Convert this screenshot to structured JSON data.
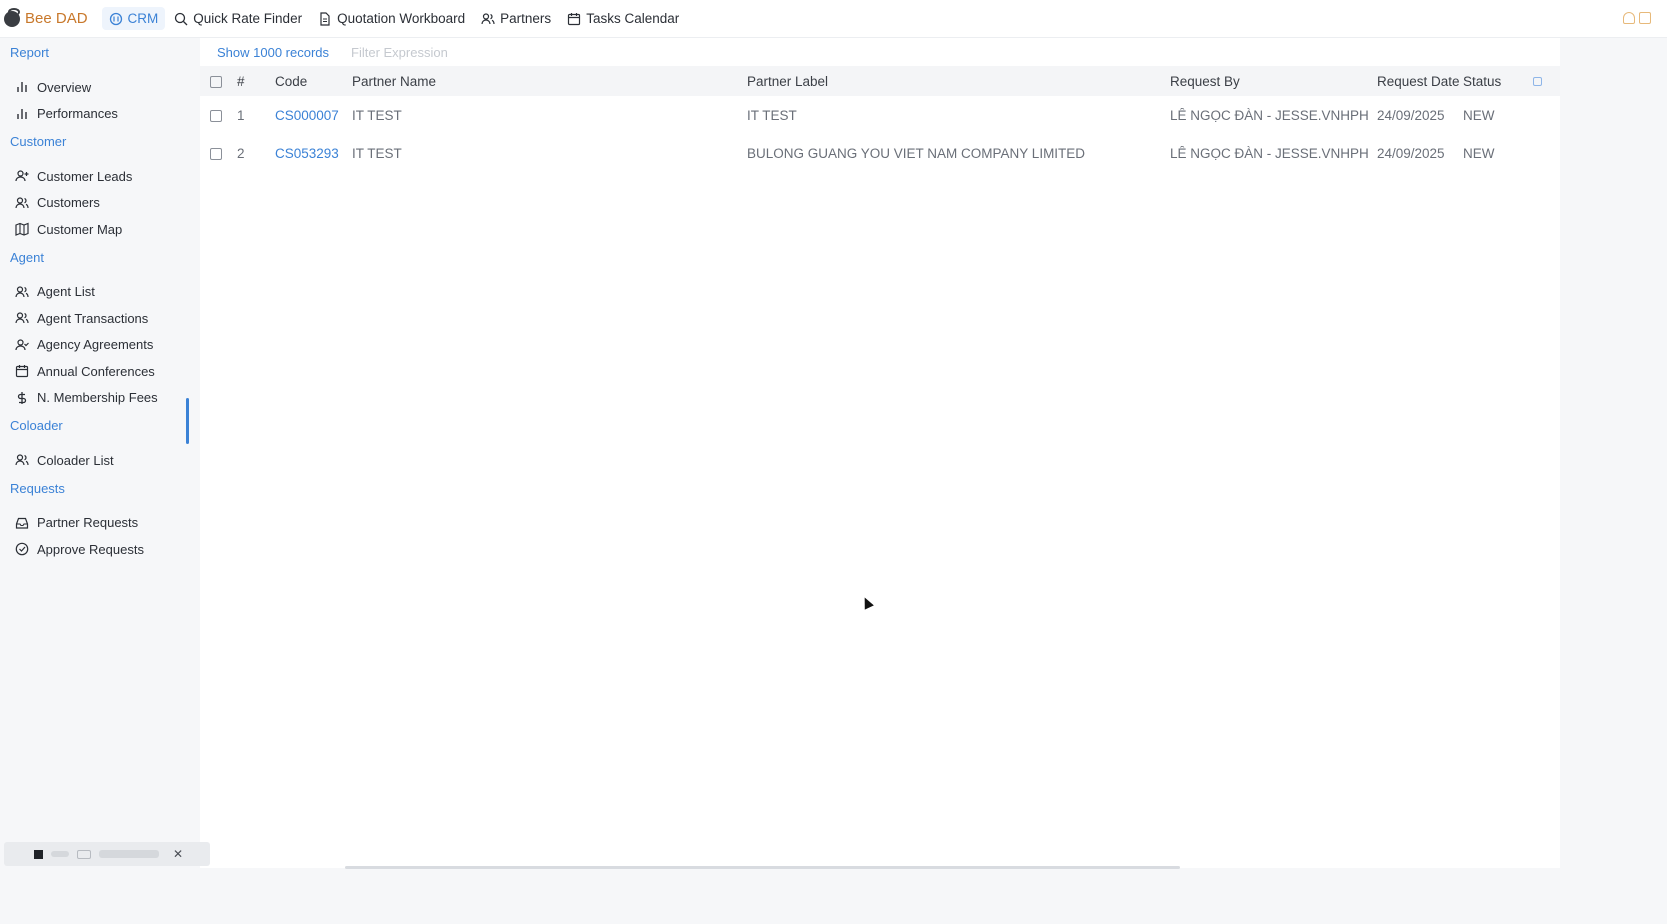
{
  "app": {
    "brand": "Bee DAD"
  },
  "nav": [
    {
      "label": "CRM",
      "icon": "crm-icon",
      "active": true
    },
    {
      "label": "Quick Rate Finder",
      "icon": "search-icon"
    },
    {
      "label": "Quotation Workboard",
      "icon": "document-icon"
    },
    {
      "label": "Partners",
      "icon": "users-icon"
    },
    {
      "label": "Tasks Calendar",
      "icon": "calendar-icon"
    }
  ],
  "sidebar": {
    "report": {
      "title": "Report",
      "items": [
        "Overview",
        "Performances"
      ]
    },
    "customer": {
      "title": "Customer",
      "items": [
        "Customer Leads",
        "Customers",
        "Customer Map"
      ]
    },
    "agent": {
      "title": "Agent",
      "items": [
        "Agent List",
        "Agent Transactions",
        "Agency Agreements",
        "Annual Conferences",
        "N. Membership Fees"
      ]
    },
    "coloader": {
      "title": "Coloader",
      "items": [
        "Coloader List"
      ]
    },
    "requests": {
      "title": "Requests",
      "items": [
        "Partner Requests",
        "Approve Requests"
      ]
    }
  },
  "toolbar": {
    "show_records": "Show 1000 records",
    "filter_placeholder": "Filter Expression"
  },
  "table": {
    "headers": {
      "num": "#",
      "code": "Code",
      "partner_name": "Partner Name",
      "partner_label": "Partner Label",
      "request_by": "Request By",
      "request_date": "Request Date",
      "status": "Status"
    },
    "rows": [
      {
        "num": "1",
        "code": "CS000007",
        "partner_name": "IT TEST",
        "partner_label": "IT TEST",
        "request_by": "LÊ NGỌC ĐÀN - JESSE.VNHPH",
        "request_date": "24/09/2025",
        "status": "NEW"
      },
      {
        "num": "2",
        "code": "CS053293",
        "partner_name": "IT TEST",
        "partner_label": "BULONG GUANG YOU VIET NAM COMPANY LIMITED",
        "request_by": "LÊ NGỌC ĐÀN - JESSE.VNHPH",
        "request_date": "24/09/2025",
        "status": "NEW"
      }
    ]
  },
  "colors": {
    "accent": "#3b82d6",
    "brand": "#c8782b"
  }
}
